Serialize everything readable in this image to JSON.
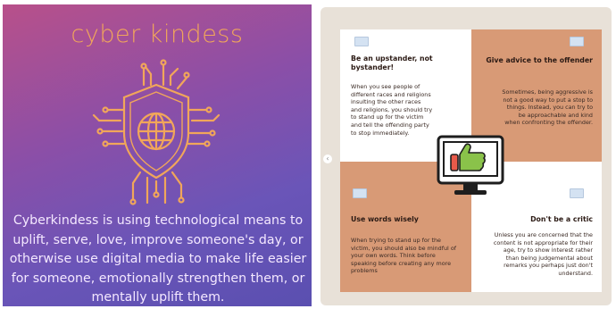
{
  "left_card": {
    "title": "cyber kindess",
    "description": "Cyberkindess is using technological means to uplift, serve, love, improve someone's day, or otherwise use digital media to make life easier for someone, emotionally strengthen them, or mentally uplift them.",
    "emblem_icon": "shield-globe-circuit-icon"
  },
  "right_panel": {
    "cards": [
      {
        "heading": "Be an upstander, not bystander!",
        "body": "When you see people of different races and religions insulting the other races and religions, you should try to stand up for the victim and tell the offending party to stop immediately."
      },
      {
        "heading": "Give advice to the offender",
        "body": "Sometimes, being aggressive is not a good way to put a stop to things. Instead, you can try to be approachable and kind when confronting the offender."
      },
      {
        "heading": "Use words wisely",
        "body": "When trying to stand up for the victim, you should also be mindful of your own words. Think before speaking before creating any more problems"
      },
      {
        "heading": "Don't be a critic",
        "body": "Unless you are concerned that the content is not appropriate for their age, try to show interest rather than being judgemental about remarks you perhaps just don't understand."
      }
    ],
    "center_icon": "monitor-thumbs-up-icon",
    "nav_icon": "chevron-left-icon"
  },
  "colors": {
    "title_orange": "#f1a65a",
    "peach": "#d89a76",
    "panel_bg": "#e8e1d8"
  }
}
